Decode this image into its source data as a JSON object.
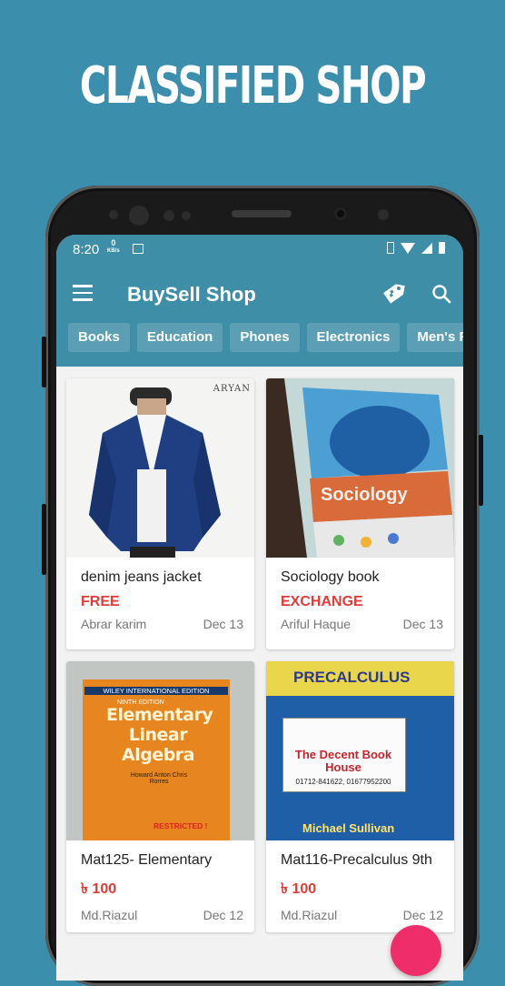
{
  "headline": "CLASSIFIED SHOP",
  "status_bar": {
    "time": "8:20",
    "speed_value": "0",
    "speed_unit": "KB/s"
  },
  "app_bar": {
    "title": "BuySell Shop"
  },
  "categories": [
    "Books",
    "Education",
    "Phones",
    "Electronics",
    "Men's Fa"
  ],
  "listings": [
    {
      "title": "denim jeans jacket",
      "price": "FREE",
      "seller": "Abrar karim",
      "date": "Dec 13",
      "photo_caption": "ARYAN"
    },
    {
      "title": "Sociology book",
      "price": "EXCHANGE",
      "seller": "Ariful Haque",
      "date": "Dec 13",
      "photo_caption": "Sociology"
    },
    {
      "title": "Mat125- Elementary",
      "price": "৳ 100",
      "seller": "Md.Riazul",
      "date": "Dec 12",
      "photo_edition": "WILEY INTERNATIONAL EDITION",
      "photo_subtitle": "NINTH EDITION",
      "photo_caption": "Elementary Linear Algebra",
      "photo_author": "Howard Anton Chris Rorres",
      "photo_note": "RESTRICTED !"
    },
    {
      "title": "Mat116-Precalculus 9th",
      "price": "৳ 100",
      "seller": "Md.Riazul",
      "date": "Dec 12",
      "photo_caption": "PRECALCULUS",
      "photo_shop": "The Decent Book House",
      "photo_phone": "01712-841622, 01677952200",
      "photo_author": "Michael Sullivan"
    }
  ],
  "colors": {
    "background": "#3b8fad",
    "app_bar": "#3d8ea6",
    "price_red": "#e53935",
    "fab": "#ef2d6b"
  },
  "icons": [
    "menu-icon",
    "tag-icon",
    "search-icon"
  ]
}
